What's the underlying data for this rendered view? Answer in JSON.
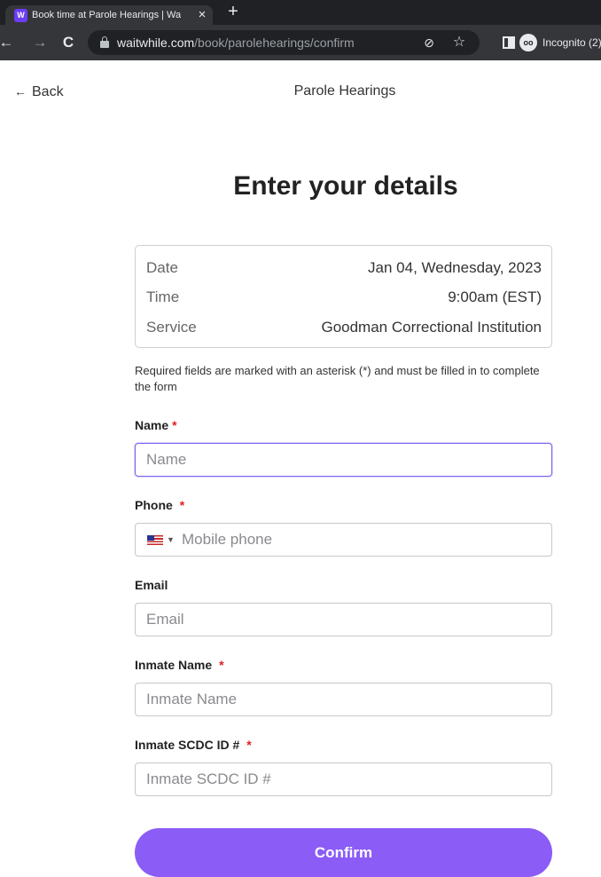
{
  "browser": {
    "tab_title": "Book time at Parole Hearings | Waitwhile",
    "url_domain": "waitwhile.com",
    "url_path": "/book/parolehearings/confirm",
    "incognito_label": "Incognito (2)"
  },
  "header": {
    "back_label": "Back",
    "title": "Parole Hearings"
  },
  "page": {
    "heading": "Enter your details"
  },
  "summary": {
    "rows": [
      {
        "label": "Date",
        "value": "Jan 04, Wednesday, 2023"
      },
      {
        "label": "Time",
        "value": "9:00am (EST)"
      },
      {
        "label": "Service",
        "value": "Goodman Correctional Institution"
      }
    ]
  },
  "notice": "Required fields are marked with an asterisk (*) and must be filled in to complete the form",
  "form": {
    "required_mark": "*",
    "name": {
      "label": "Name",
      "placeholder": "Name",
      "value": ""
    },
    "phone": {
      "label": "Phone",
      "placeholder": "Mobile phone",
      "value": "",
      "country": "US"
    },
    "email": {
      "label": "Email",
      "placeholder": "Email",
      "value": ""
    },
    "inmate_name": {
      "label": "Inmate Name",
      "placeholder": "Inmate Name",
      "value": ""
    },
    "inmate_id": {
      "label": "Inmate SCDC ID #",
      "placeholder": "Inmate SCDC ID #",
      "value": ""
    },
    "confirm_label": "Confirm"
  },
  "colors": {
    "accent": "#8b5cf6",
    "focus_border": "#7b61f5",
    "required": "#e02020",
    "chrome_dark": "#202124"
  }
}
